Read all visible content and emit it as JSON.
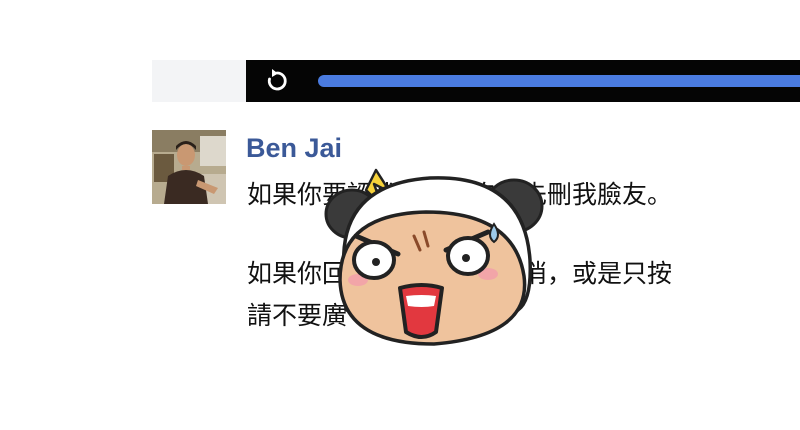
{
  "video": {
    "progress_fraction": 1.0,
    "colors": {
      "fill": "#4a7be0",
      "bar": "#050505"
    }
  },
  "post": {
    "author": "Ben Jai",
    "lines": [
      "如果你要認我讚，請自己先刪我臉友。",
      "如果你回覆評論而無法取消，或是只按",
      "請不要廣"
    ]
  },
  "sticker": {
    "icon": "angry-panda-sticker-icon"
  },
  "colors": {
    "author": "#3b5998"
  }
}
